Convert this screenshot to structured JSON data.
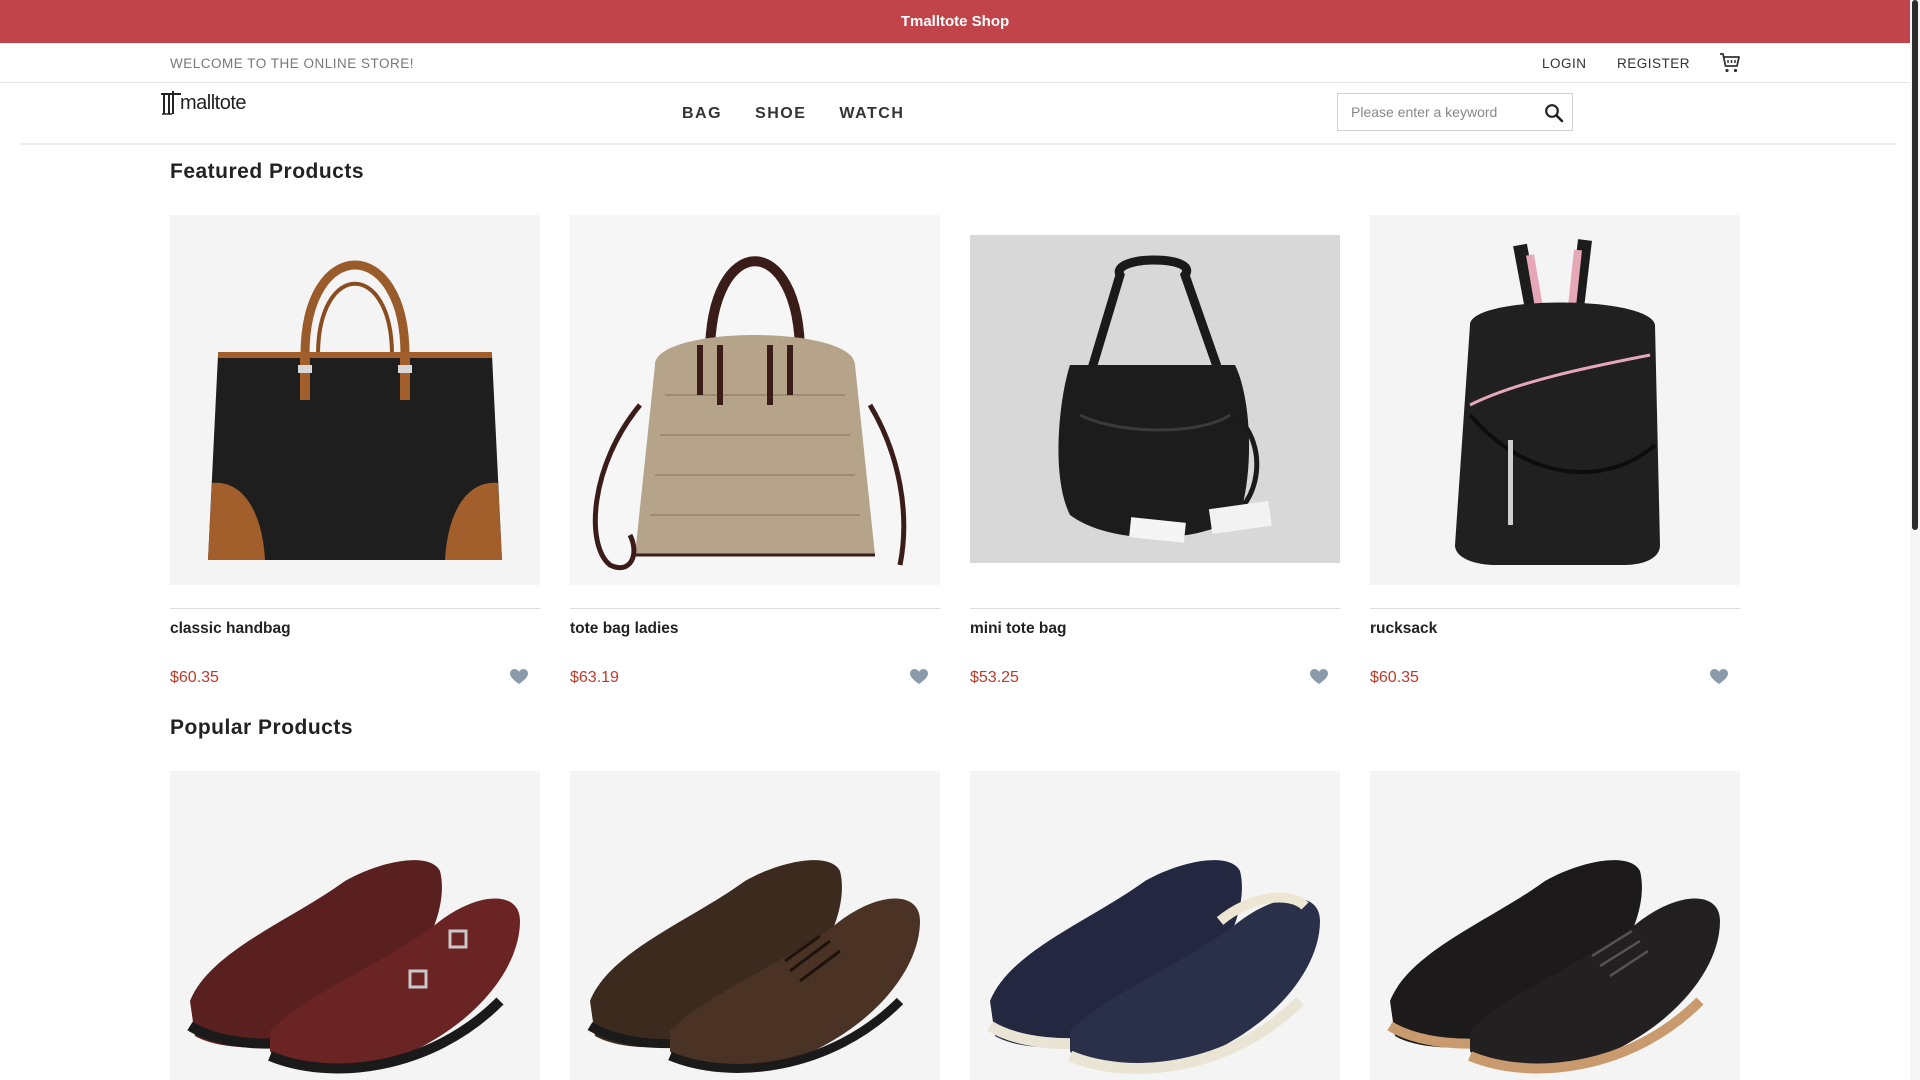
{
  "banner": {
    "title": "Tmalltote Shop"
  },
  "topbar": {
    "welcome": "WELCOME TO THE ONLINE STORE!",
    "login": "LOGIN",
    "register": "REGISTER"
  },
  "header": {
    "logo_text": "malltote",
    "nav": [
      "BAG",
      "SHOE",
      "WATCH"
    ],
    "search_placeholder": "Please enter a keyword"
  },
  "featured": {
    "title": "Featured Products",
    "products": [
      {
        "name": "classic handbag",
        "price": "$60.35"
      },
      {
        "name": "tote bag ladies",
        "price": "$63.19"
      },
      {
        "name": "mini tote bag",
        "price": "$53.25"
      },
      {
        "name": "rucksack",
        "price": "$60.35"
      }
    ]
  },
  "popular": {
    "title": "Popular Products",
    "products": [
      {
        "name": "",
        "price": ""
      },
      {
        "name": "",
        "price": ""
      },
      {
        "name": "",
        "price": ""
      },
      {
        "name": "",
        "price": ""
      }
    ]
  },
  "colors": {
    "banner": "#c0444a",
    "price": "#c0392b",
    "heart": "#8a9aab"
  }
}
